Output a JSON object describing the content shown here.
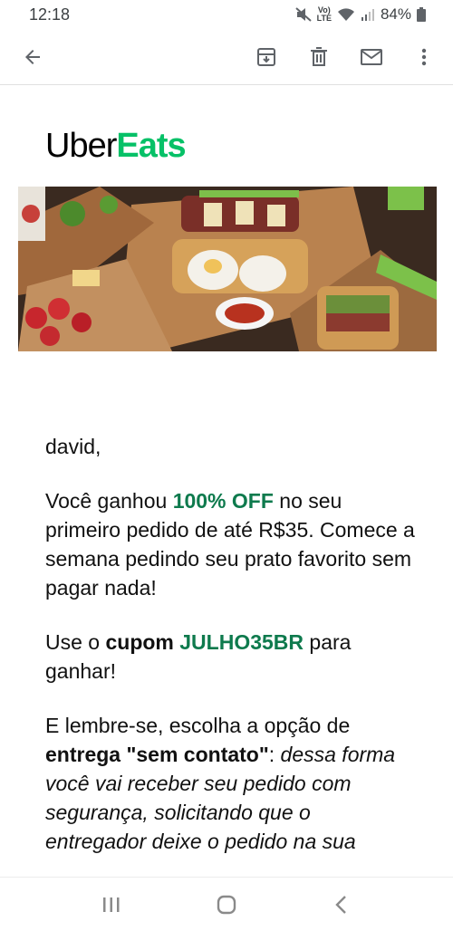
{
  "status_bar": {
    "time": "12:18",
    "battery": "84%",
    "volte_top": "Vo)",
    "volte_bottom": "LTE",
    "icons": [
      "mute-icon",
      "volte-icon",
      "wifi-icon",
      "signal-icon",
      "battery-icon"
    ]
  },
  "toolbar": {
    "icons": [
      "back-arrow-icon",
      "archive-icon",
      "trash-icon",
      "mail-icon",
      "more-vert-icon"
    ]
  },
  "email": {
    "brand_uber": "Uber",
    "brand_eats": "Eats",
    "greeting": "david,",
    "p1_a": "Você ganhou ",
    "p1_offer": "100% OFF",
    "p1_b": " no seu primeiro pedido de até R$35. Comece a semana pedindo seu prato favorito sem pagar nada!",
    "p2_a": "Use o ",
    "p2_cupom": "cupom",
    "p2_space": " ",
    "p2_code": "JULHO35BR",
    "p2_b": " para ganhar!",
    "p3_a": "E lembre-se, escolha a opção de ",
    "p3_bold": "entrega \"sem contato\"",
    "p3_colon": ": ",
    "p3_italic": "dessa forma você vai receber seu pedido com segurança, solicitando que o entregador deixe o pedido na sua"
  },
  "colors": {
    "brand_green": "#06c167",
    "offer_green": "#0e7a4d"
  },
  "nav": {
    "icons": [
      "recent-apps-icon",
      "home-icon",
      "back-icon"
    ]
  }
}
